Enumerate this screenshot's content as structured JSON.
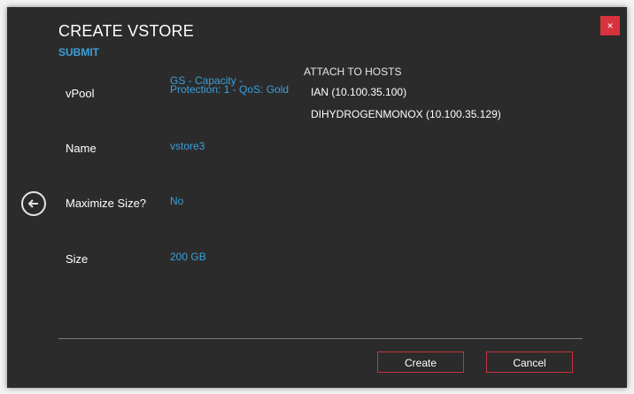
{
  "dialog": {
    "title": "CREATE VSTORE",
    "subtitle": "SUBMIT",
    "close_label": "×"
  },
  "fields": {
    "vpool": {
      "label": "vPool",
      "value": "GS - Capacity - Protection: 1 - QoS: Gold"
    },
    "name": {
      "label": "Name",
      "value": "vstore3"
    },
    "maximize": {
      "label": "Maximize Size?",
      "value": "No"
    },
    "size": {
      "label": "Size",
      "value": "200 GB"
    }
  },
  "hosts": {
    "header": "ATTACH TO HOSTS",
    "items": [
      "IAN (10.100.35.100)",
      "DIHYDROGENMONOX (10.100.35.129)"
    ]
  },
  "buttons": {
    "create": "Create",
    "cancel": "Cancel"
  },
  "colors": {
    "background": "#2b2b2b",
    "accent_blue": "#3aa0dc",
    "button_border_red": "#c8323c",
    "close_red": "#d8323c"
  }
}
